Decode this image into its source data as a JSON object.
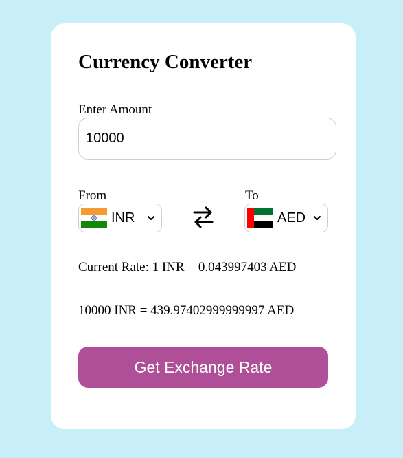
{
  "converter": {
    "title": "Currency Converter",
    "amount_label": "Enter Amount",
    "amount_value": "10000",
    "from_label": "From",
    "to_label": "To",
    "from_currency": "INR",
    "to_currency": "AED",
    "from_flag_icon": "india-flag-icon",
    "to_flag_icon": "uae-flag-icon",
    "swap_icon": "swap-arrows-icon",
    "rate_text": "Current Rate: 1 INR = 0.043997403 AED",
    "result_text": "10000 INR = 439.97402999999997 AED",
    "button_label": "Get Exchange Rate"
  },
  "colors": {
    "page_background": "#c8eef7",
    "card_background": "#ffffff",
    "button_background": "#af4f98",
    "button_text": "#ffffff"
  }
}
